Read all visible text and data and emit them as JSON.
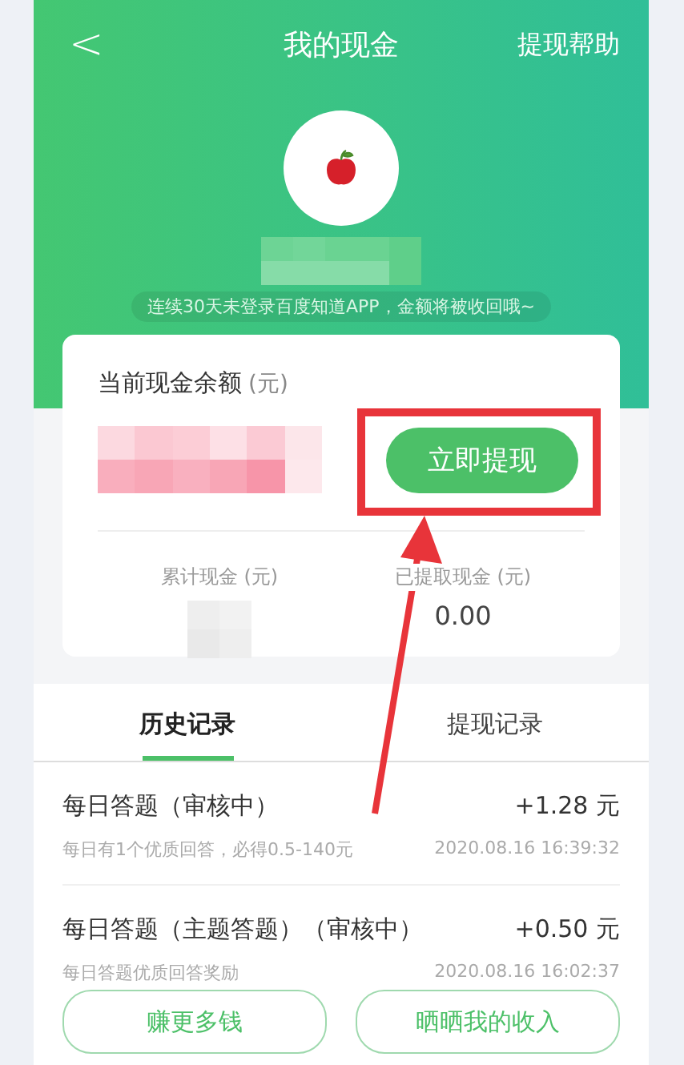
{
  "header": {
    "back": "<",
    "title": "我的现金",
    "help": "提现帮助",
    "notice": "连续30天未登录百度知道APP，金额将被收回哦~"
  },
  "balance": {
    "label": "当前现金余额",
    "unit": "(元)",
    "button": "立即提现"
  },
  "stats": [
    {
      "label": "累计现金 (元)"
    },
    {
      "label": "已提取现金 (元)",
      "value": "0.00"
    }
  ],
  "tabs": [
    {
      "label": "历史记录",
      "selected": true
    },
    {
      "label": "提现记录",
      "selected": false
    }
  ],
  "records": [
    {
      "title": "每日答题（审核中）",
      "amount": "+1.28 元",
      "note": "每日有1个优质回答，必得0.5-140元",
      "time": "2020.08.16 16:39:32"
    },
    {
      "title": "每日答题（主题答题）（审核中）",
      "amount": "+0.50 元",
      "note": "每日答题优质回答奖励",
      "time": "2020.08.16 16:02:37"
    }
  ],
  "footer_buttons": [
    "赚更多钱",
    "晒晒我的收入"
  ],
  "annotations": [
    {
      "kind": "box"
    },
    {
      "kind": "arrow"
    }
  ]
}
